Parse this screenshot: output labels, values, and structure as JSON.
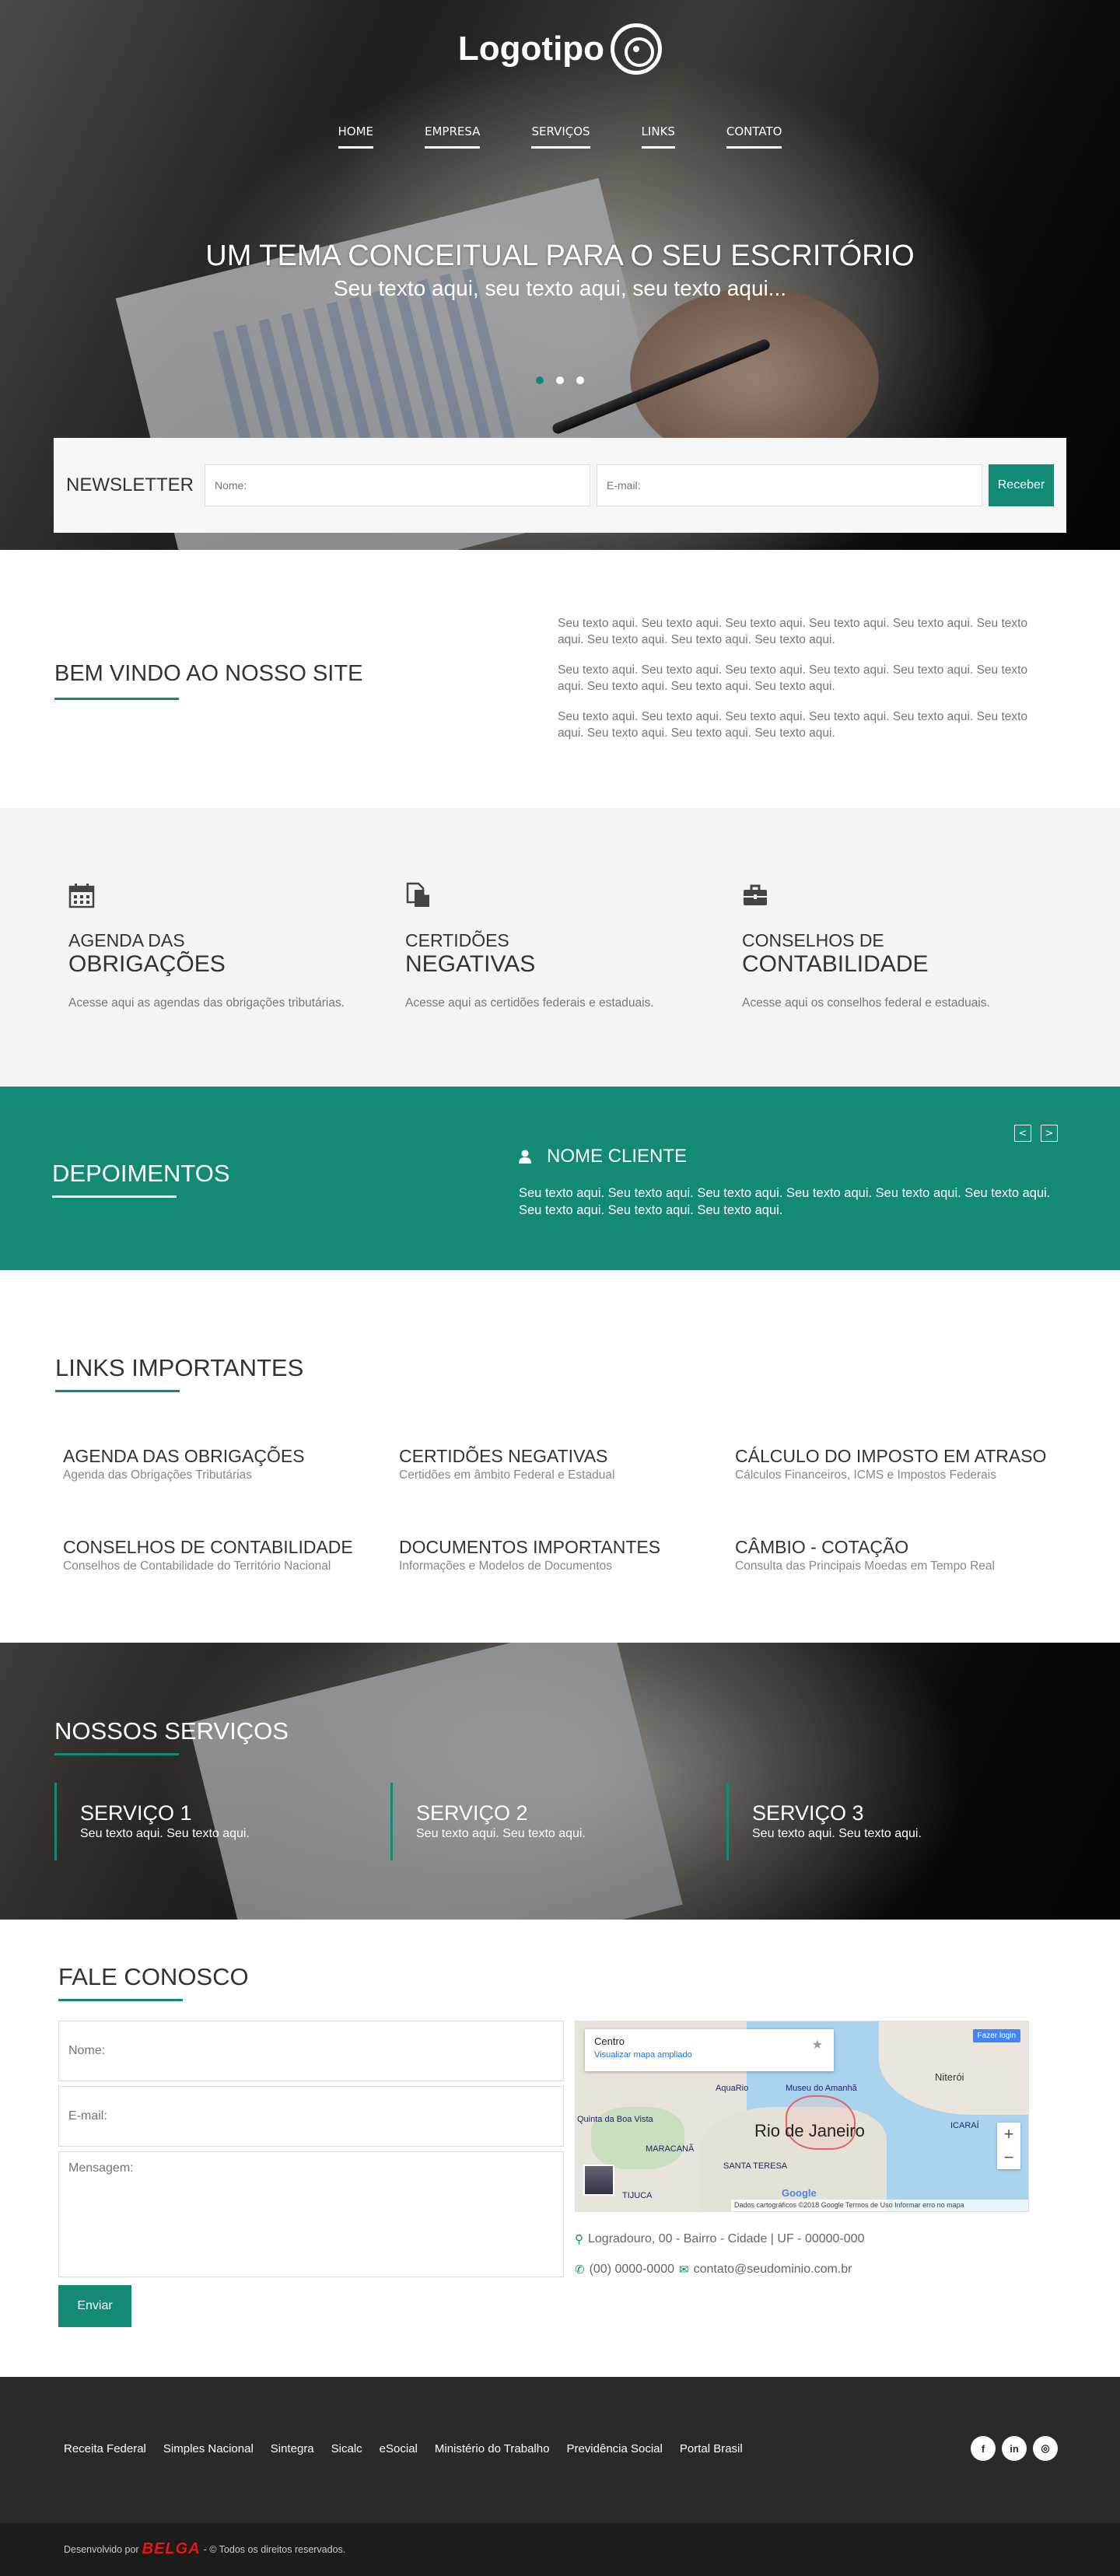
{
  "header": {
    "logo_text": "Logotipo",
    "nav": [
      "HOME",
      "EMPRESA",
      "SERVIÇOS",
      "LINKS",
      "CONTATO"
    ]
  },
  "hero": {
    "title": "UM TEMA CONCEITUAL PARA O SEU ESCRITÓRIO",
    "subtitle": "Seu texto aqui, seu texto aqui, seu texto aqui...",
    "slides": 3,
    "active_slide": 1
  },
  "newsletter": {
    "label": "NEWSLETTER",
    "name_placeholder": "Nome:",
    "email_placeholder": "E-mail:",
    "button": "Receber"
  },
  "welcome": {
    "title": "BEM VINDO AO NOSSO SITE",
    "paragraphs": [
      "Seu texto aqui. Seu texto aqui. Seu texto aqui. Seu texto aqui. Seu texto aqui. Seu texto aqui. Seu texto aqui. Seu texto aqui. Seu texto aqui.",
      "Seu texto aqui. Seu texto aqui. Seu texto aqui. Seu texto aqui. Seu texto aqui. Seu texto aqui. Seu texto aqui. Seu texto aqui. Seu texto aqui.",
      "Seu texto aqui. Seu texto aqui. Seu texto aqui. Seu texto aqui. Seu texto aqui. Seu texto aqui. Seu texto aqui. Seu texto aqui. Seu texto aqui."
    ]
  },
  "features": [
    {
      "icon": "calendar-icon",
      "line1": "AGENDA DAS",
      "line2": "OBRIGAÇÕES",
      "desc": "Acesse aqui as agendas das obrigações tributárias."
    },
    {
      "icon": "documents-icon",
      "line1": "CERTIDÕES",
      "line2": "NEGATIVAS",
      "desc": "Acesse aqui as certidões federais e estaduais."
    },
    {
      "icon": "briefcase-icon",
      "line1": "CONSELHOS DE",
      "line2": "CONTABILIDADE",
      "desc": "Acesse aqui os conselhos federal e estaduais."
    }
  ],
  "testimonials": {
    "title": "DEPOIMENTOS",
    "name": "NOME CLIENTE",
    "text": "Seu texto aqui. Seu texto aqui. Seu texto aqui. Seu texto aqui. Seu texto aqui. Seu texto aqui. Seu texto aqui. Seu texto aqui. Seu texto aqui.",
    "prev": "<",
    "next": ">"
  },
  "links": {
    "title": "LINKS IMPORTANTES",
    "items": [
      {
        "title": "AGENDA DAS OBRIGAÇÕES",
        "desc": "Agenda das Obrigações Tributárias"
      },
      {
        "title": "CERTIDÕES NEGATIVAS",
        "desc": "Certidões em âmbito Federal e Estadual"
      },
      {
        "title": "CÁLCULO DO IMPOSTO EM ATRASO",
        "desc": "Cálculos Financeiros, ICMS e Impostos Federais"
      },
      {
        "title": "CONSELHOS DE CONTABILIDADE",
        "desc": "Conselhos de Contabilidade do Território Nacional"
      },
      {
        "title": "DOCUMENTOS IMPORTANTES",
        "desc": "Informações e Modelos de Documentos"
      },
      {
        "title": "CÂMBIO - COTAÇÃO",
        "desc": "Consulta das Principais Moedas em Tempo Real"
      }
    ]
  },
  "services": {
    "title": "NOSSOS SERVIÇOS",
    "items": [
      {
        "title": "SERVIÇO 1",
        "desc": "Seu texto aqui. Seu texto aqui."
      },
      {
        "title": "SERVIÇO 2",
        "desc": "Seu texto aqui. Seu texto aqui."
      },
      {
        "title": "SERVIÇO 3",
        "desc": "Seu texto aqui. Seu texto aqui."
      }
    ]
  },
  "contact": {
    "title": "FALE CONOSCO",
    "name_placeholder": "Nome:",
    "email_placeholder": "E-mail:",
    "message_placeholder": "Mensagem:",
    "button": "Enviar",
    "address": "Logradouro, 00 - Bairro - Cidade | UF - 00000-000",
    "phone": "(00) 0000-0000",
    "email": "contato@seudominio.com.br",
    "map": {
      "place": "Centro",
      "link": "Visualizar mapa ampliado",
      "login": "Fazer login",
      "city": "Rio de Janeiro",
      "labels": [
        "Niterói",
        "ICARAÍ",
        "MARACANÃ",
        "SANTA TERESA",
        "TIJUCA",
        "Quinta da Boa Vista",
        "AquaRio",
        "Museu do Amanhã"
      ],
      "attribution": "Dados cartográficos ©2018 Google   Termos de Uso   Informar erro no mapa",
      "brand": "Google",
      "zoom_in": "+",
      "zoom_out": "−"
    }
  },
  "footer": {
    "links": [
      "Receita Federal",
      "Simples Nacional",
      "Sintegra",
      "Sicalc",
      "eSocial",
      "Ministério do Trabalho",
      "Previdência Social",
      "Portal Brasil"
    ],
    "social": [
      "facebook-icon",
      "linkedin-icon",
      "instagram-icon"
    ],
    "social_glyphs": [
      "f",
      "in",
      "◎"
    ],
    "dev_prefix": "Desenvolvido por",
    "dev_brand": "BELGA",
    "dev_suffix": "- © Todos os direitos reservados."
  },
  "colors": {
    "accent": "#138a74",
    "footer": "#2a2a2a",
    "footer_bottom": "#1c1c1c"
  }
}
